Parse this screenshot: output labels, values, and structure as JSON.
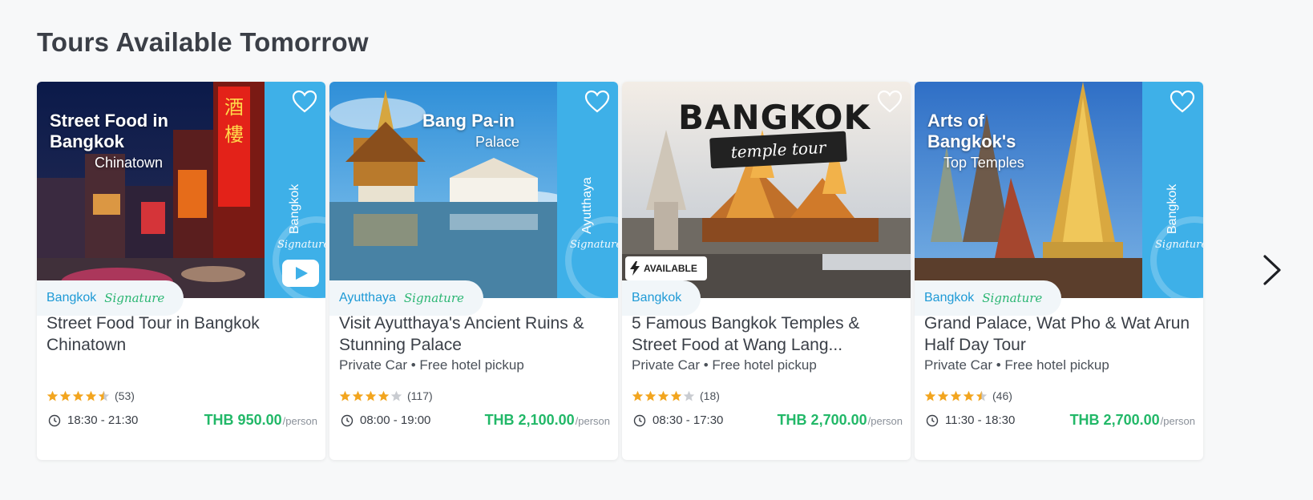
{
  "section": {
    "title": "Tours Available Tomorrow"
  },
  "colors": {
    "accent_blue": "#3eb0e8",
    "price_green": "#22b868",
    "star_gold": "#f2a51f"
  },
  "cards": [
    {
      "image_caption": "Street Food in Bangkok",
      "image_caption_sub": "Chinatown",
      "side_label": "Bangkok",
      "signature_script": "Signature",
      "city": "Bangkok",
      "signature": "Signature",
      "title": "Street Food Tour in Bangkok Chinatown",
      "subtitle": "",
      "rating": 4.5,
      "reviews": "(53)",
      "time": "18:30 - 21:30",
      "price": "THB 950.00",
      "price_unit": "/person"
    },
    {
      "image_caption": "Bang Pa-in",
      "image_caption_sub": "Palace",
      "side_label": "Ayutthaya",
      "signature_script": "Signature",
      "city": "Ayutthaya",
      "signature": "Signature",
      "title": "Visit Ayutthaya's Ancient Ruins & Stunning Palace",
      "subtitle": "Private Car • Free hotel pickup",
      "rating": 4.0,
      "reviews": "(117)",
      "time": "08:00 - 19:00",
      "price": "THB 2,100.00",
      "price_unit": "/person"
    },
    {
      "banner_title": "BANGKOK",
      "banner_sub": "temple tour",
      "badge": "AVAILABLE",
      "city": "Bangkok",
      "title": "5 Famous Bangkok Temples & Street Food at Wang Lang...",
      "subtitle": "Private Car • Free hotel pickup",
      "rating": 4.0,
      "reviews": "(18)",
      "time": "08:30 - 17:30",
      "price": "THB 2,700.00",
      "price_unit": "/person"
    },
    {
      "image_caption": "Arts of Bangkok's",
      "image_caption_sub": "Top Temples",
      "side_label": "Bangkok",
      "signature_script": "Signature",
      "city": "Bangkok",
      "signature": "Signature",
      "title": "Grand Palace, Wat Pho & Wat Arun Half Day Tour",
      "subtitle": "Private Car • Free hotel pickup",
      "rating": 4.5,
      "reviews": "(46)",
      "time": "11:30 - 18:30",
      "price": "THB 2,700.00",
      "price_unit": "/person"
    }
  ],
  "icons": {
    "favorite": "heart-icon",
    "video": "play-icon",
    "time": "clock-icon",
    "next": "chevron-right-icon"
  }
}
